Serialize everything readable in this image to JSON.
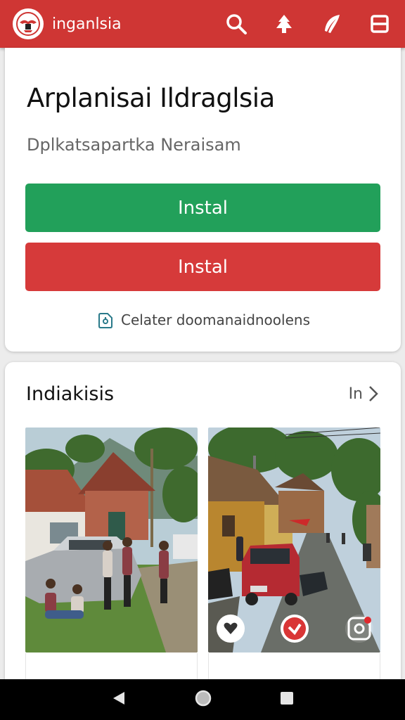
{
  "header": {
    "app_name": "inganlsia",
    "icons": [
      "search-icon",
      "tree-icon",
      "feather-icon",
      "menu-icon"
    ],
    "color": "#cf3634"
  },
  "app_card": {
    "title": "Arplanisai Ildraglsia",
    "subtitle": "Dplkatsapartka Neraisam",
    "install_primary": "Instal",
    "install_secondary": "Instal",
    "info_text": "Celater doomanaidnoolens",
    "info_icon": "lock-icon"
  },
  "gallery": {
    "title": "Indiakisis",
    "more_label": "In",
    "photos": [
      {
        "description_icon": "village-photo"
      },
      {
        "description_icon": "street-photo",
        "actions": [
          "heart-icon",
          "check-icon",
          "camera-icon"
        ]
      }
    ]
  },
  "system_nav": {
    "buttons": [
      "back-icon",
      "home-icon",
      "recents-icon"
    ]
  },
  "colors": {
    "accent_red": "#cf3634",
    "install_green": "#22a05a",
    "install_red": "#d63a3a"
  }
}
